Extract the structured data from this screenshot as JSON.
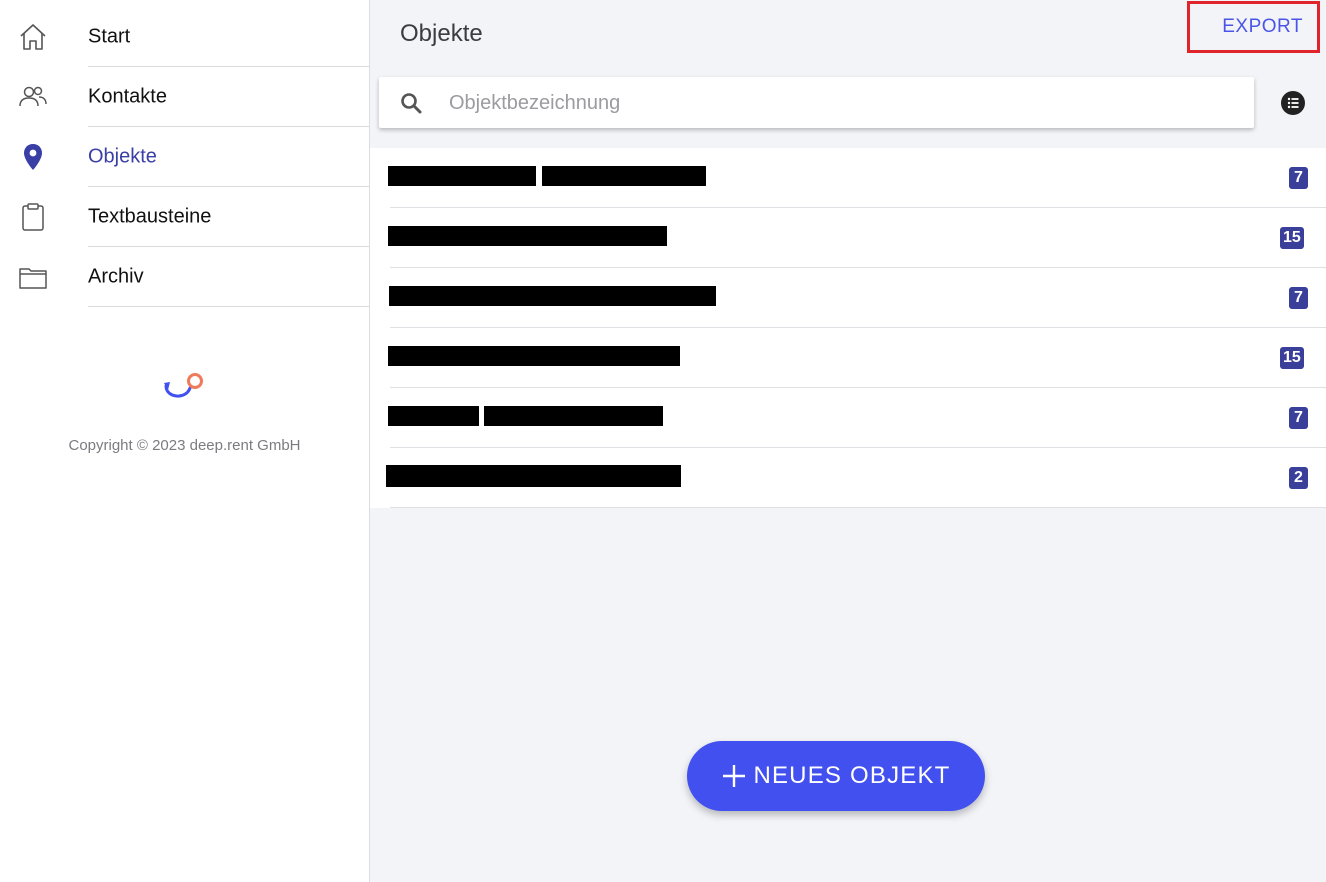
{
  "sidebar": {
    "items": [
      {
        "label": "Start",
        "icon": "home-icon",
        "active": false
      },
      {
        "label": "Kontakte",
        "icon": "users-icon",
        "active": false
      },
      {
        "label": "Objekte",
        "icon": "location-pin-icon",
        "active": true
      },
      {
        "label": "Textbausteine",
        "icon": "clipboard-icon",
        "active": false
      },
      {
        "label": "Archiv",
        "icon": "folder-icon",
        "active": false
      }
    ],
    "copyright": "Copyright © 2023 deep.rent GmbH"
  },
  "header": {
    "title": "Objekte",
    "export_label": "EXPORT"
  },
  "search": {
    "placeholder": "Objektbezeichnung",
    "value": ""
  },
  "objects": [
    {
      "name": "[redacted]",
      "count": "7"
    },
    {
      "name": "[redacted]",
      "count": "15"
    },
    {
      "name": "[redacted]",
      "count": "7"
    },
    {
      "name": "[redacted]",
      "count": "15"
    },
    {
      "name": "[redacted]",
      "count": "7"
    },
    {
      "name": "[redacted]",
      "count": "2"
    }
  ],
  "actions": {
    "new_object_label": "NEUES OBJEKT"
  },
  "colors": {
    "accent": "#4350f0",
    "active_nav": "#3a3fa6",
    "badge": "#3a3f99",
    "export_highlight": "#e0242c",
    "main_background": "#f3f4f8"
  }
}
